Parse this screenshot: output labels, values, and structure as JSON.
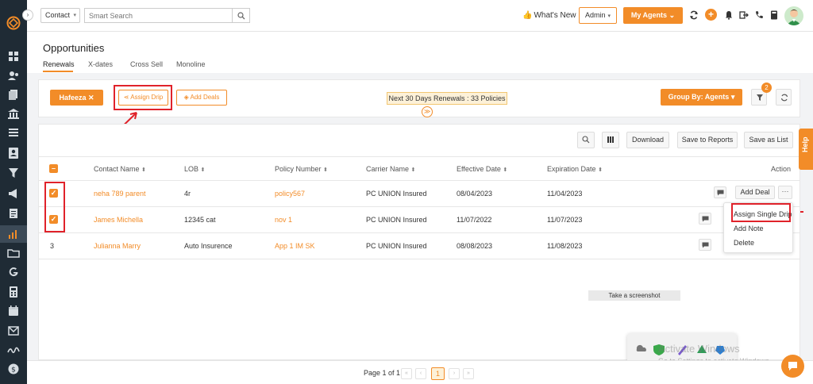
{
  "topbar": {
    "contact_select": "Contact",
    "search_placeholder": "Smart Search",
    "whats_new": "What's New",
    "admin_select": "Admin",
    "my_agents": "My Agents"
  },
  "page": {
    "title": "Opportunities",
    "tabs": [
      "Renewals",
      "X-dates",
      "Cross Sell",
      "Monoline"
    ],
    "active_tab": "Renewals"
  },
  "filters": {
    "agent_chip": "Hafeeza",
    "assign_drip": "Assign Drip",
    "add_deals": "Add Deals",
    "renewals_summary": "Next 30 Days Renewals : 33 Policies",
    "group_by": "Group By: Agents",
    "filter_count": "2"
  },
  "toolbar": {
    "download": "Download",
    "save_to_reports": "Save to Reports",
    "save_as_list": "Save as List"
  },
  "table": {
    "columns": [
      "Contact Name",
      "LOB",
      "Policy Number",
      "Carrier Name",
      "Effective Date",
      "Expiration Date",
      "Action"
    ],
    "rows": [
      {
        "contact": "neha 789 parent",
        "lob": "4r",
        "policy": "policy567",
        "carrier": "PC UNION Insured",
        "effective": "08/04/2023",
        "expiration": "11/04/2023"
      },
      {
        "contact": "James Michella",
        "lob": "12345 cat",
        "policy": "nov 1",
        "carrier": "PC UNION Insured",
        "effective": "11/07/2022",
        "expiration": "11/07/2023"
      },
      {
        "index": "3",
        "contact": "Julianna Marry",
        "lob": "Auto Insurence",
        "policy": "App 1 IM SK",
        "carrier": "PC UNION Insured",
        "effective": "08/08/2023",
        "expiration": "11/08/2023"
      }
    ],
    "add_deal": "Add Deal",
    "more": "···"
  },
  "action_menu": {
    "items": [
      "Assign Single Drip",
      "Add Note",
      "Delete"
    ]
  },
  "pagination": {
    "text": "Page 1 of 1",
    "current": "1",
    "first": "«",
    "prev": "‹",
    "next": "›",
    "last": "»"
  },
  "overlay": {
    "screenshot_tip": "Take a screenshot",
    "watermark_title": "Activate Windows",
    "watermark_sub": "Go to Settings to activate Windows."
  },
  "help_tab": "Help",
  "colors": {
    "accent": "#f28c28",
    "sidebar": "#1f2b35",
    "annotation": "#e0222a"
  }
}
